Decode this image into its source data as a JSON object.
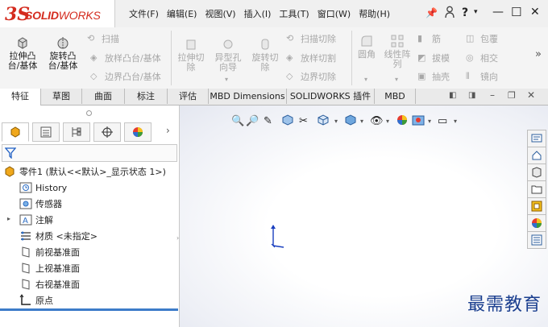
{
  "app": {
    "logo_ds": "3S",
    "logo_text_solid": "SOLID",
    "logo_text_works": "WORKS"
  },
  "menu": [
    {
      "label": "文件(F)"
    },
    {
      "label": "编辑(E)"
    },
    {
      "label": "视图(V)"
    },
    {
      "label": "插入(I)"
    },
    {
      "label": "工具(T)"
    },
    {
      "label": "窗口(W)"
    },
    {
      "label": "帮助(H)"
    }
  ],
  "window_controls": {
    "pin": "📌",
    "user": "👤",
    "help": "?",
    "minimize": "—",
    "maximize": "☐",
    "close": "✕"
  },
  "ribbon": {
    "extrude_boss": "拉伸凸\n台/基体",
    "revolve_boss": "旋转凸\n台/基体",
    "sweep": "扫描",
    "loft": "放样凸台/基体",
    "boundary": "边界凸台/基体",
    "extrude_cut": "拉伸切\n除",
    "hole_wizard": "异型孔\n向导",
    "revolve_cut": "旋转切\n除",
    "sweep_cut": "扫描切除",
    "loft_cut": "放样切割",
    "boundary_cut": "边界切除",
    "fillet": "圆角",
    "linear_pattern": "线性阵\n列",
    "rib": "筋",
    "draft": "拔模",
    "shell": "抽壳",
    "wrap": "包覆",
    "intersect": "相交",
    "mirror": "镜向",
    "expand": "»"
  },
  "tabs": [
    {
      "label": "特征"
    },
    {
      "label": "草图"
    },
    {
      "label": "曲面"
    },
    {
      "label": "标注"
    },
    {
      "label": "评估"
    },
    {
      "label": "MBD Dimensions"
    },
    {
      "label": "SOLIDWORKS 插件"
    },
    {
      "label": "MBD"
    }
  ],
  "tree": {
    "root": "零件1 (默认<<默认>_显示状态 1>)",
    "items": [
      {
        "label": "History"
      },
      {
        "label": "传感器"
      },
      {
        "label": "注解"
      },
      {
        "label": "材质 <未指定>"
      },
      {
        "label": "前视基准面"
      },
      {
        "label": "上视基准面"
      },
      {
        "label": "右视基准面"
      },
      {
        "label": "原点"
      }
    ]
  },
  "watermark": "最需教育",
  "colors": {
    "brand_red": "#d42b1e",
    "watermark_blue": "#1b3f8f",
    "selection_blue": "#3d7cc9"
  }
}
